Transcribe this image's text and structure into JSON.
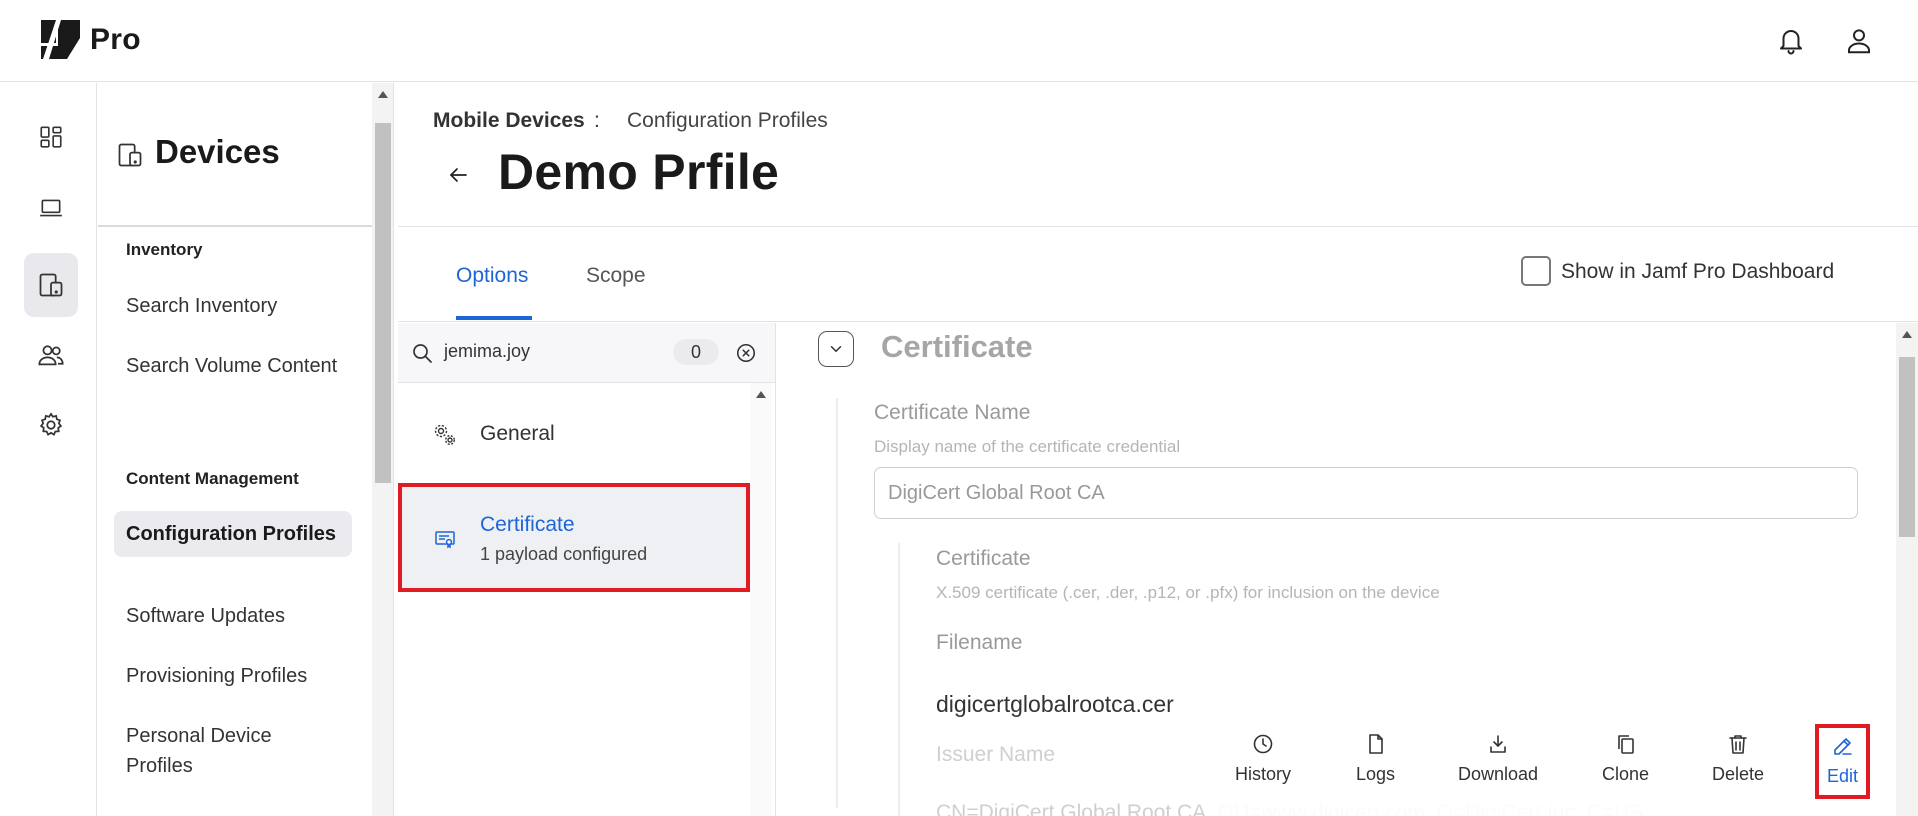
{
  "app": {
    "name": "Pro"
  },
  "breadcrumb": {
    "section": "Mobile Devices",
    "separator": ":",
    "page": "Configuration Profiles"
  },
  "page": {
    "title": "Demo Prfile"
  },
  "sidebar": {
    "title": "Devices",
    "sections": [
      {
        "title": "Inventory",
        "items": [
          "Search Inventory",
          "Search Volume Content"
        ]
      },
      {
        "title": "Content Management",
        "items": [
          "Configuration Profiles",
          "Software Updates",
          "Provisioning Profiles",
          "Personal Device Profiles"
        ]
      }
    ],
    "active_item": "Configuration Profiles"
  },
  "rail": {
    "icons": [
      "dashboard-icon",
      "computer-icon",
      "mobile-devices-icon",
      "users-icon",
      "settings-icon"
    ],
    "active": "mobile-devices-icon"
  },
  "tabs": [
    {
      "label": "Options",
      "active": true
    },
    {
      "label": "Scope",
      "active": false
    }
  ],
  "dashboard_option": {
    "label": "Show in Jamf Pro Dashboard",
    "checked": false
  },
  "payload_search": {
    "value": "jemima.joy",
    "count": "0"
  },
  "payloads": [
    {
      "label": "General",
      "sub": "",
      "active": false
    },
    {
      "label": "Certificate",
      "sub": "1 payload configured",
      "active": true
    }
  ],
  "detail": {
    "title": "Certificate",
    "certificate_name": {
      "label": "Certificate Name",
      "help": "Display name of the certificate credential",
      "value": "DigiCert Global Root CA"
    },
    "certificate": {
      "label": "Certificate",
      "help": "X.509 certificate (.cer, .der, .p12, or .pfx) for inclusion on the device"
    },
    "filename": {
      "label": "Filename",
      "value": "digicertglobalrootca.cer"
    },
    "issuer_name": {
      "label": "Issuer Name",
      "value": "CN=DigiCert Global Root CA, OU=www.digicert.com, O=DigiCert Inc, C=US"
    }
  },
  "actions": [
    "History",
    "Logs",
    "Download",
    "Clone",
    "Delete",
    "Edit"
  ],
  "colors": {
    "accent": "#1d66d6",
    "highlight": "#e01b24",
    "muted": "#9a9a9a"
  }
}
